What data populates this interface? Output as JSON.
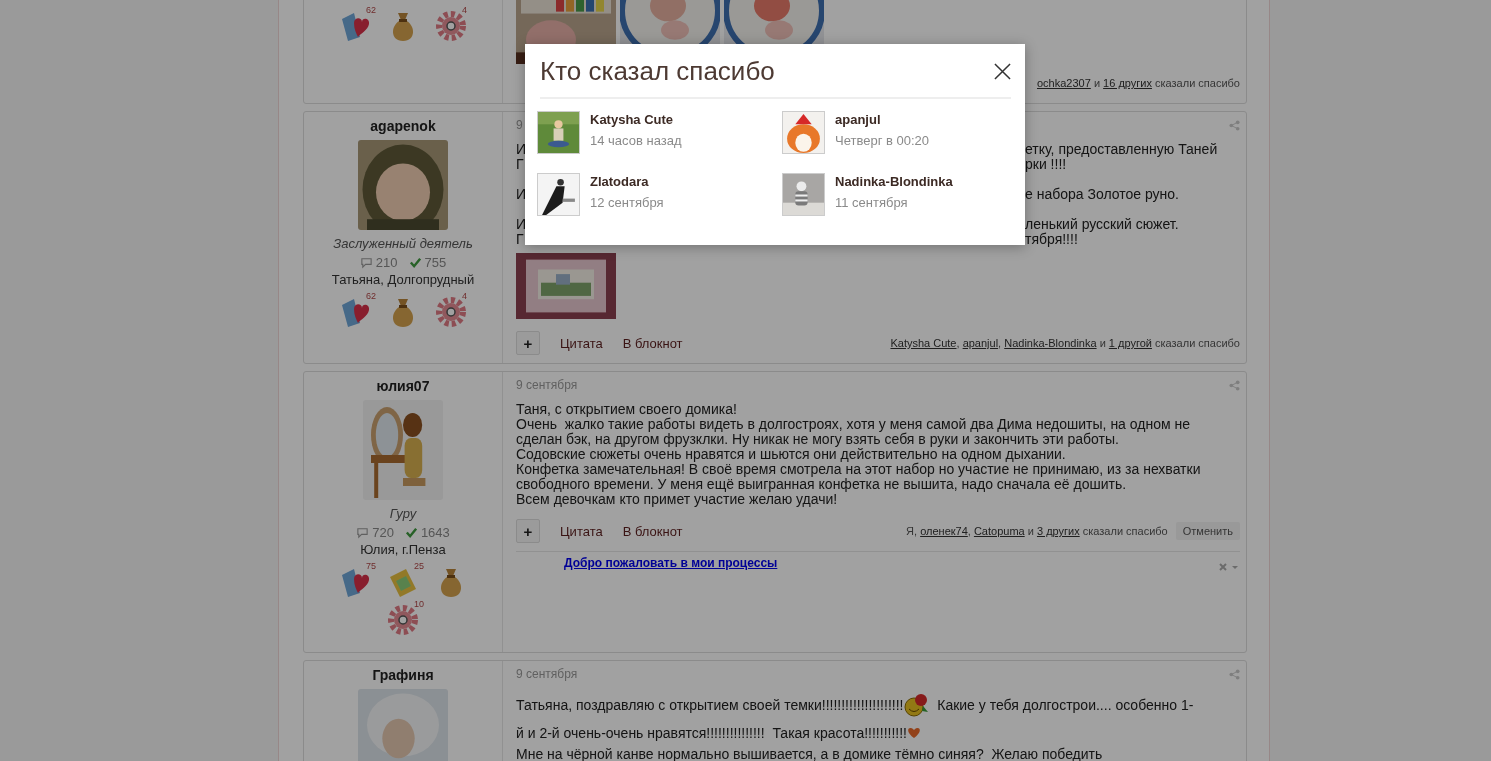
{
  "posts": [
    {
      "badges": [
        {
          "kind": "heart",
          "count": "62"
        },
        {
          "kind": "bag"
        },
        {
          "kind": "gear",
          "count": "4"
        }
      ],
      "attachments": [
        {
          "kind": "picture"
        },
        {
          "kind": "picture"
        },
        {
          "kind": "picture"
        }
      ],
      "thanks": [
        {
          "kind": "link",
          "text": "ochka2307"
        },
        {
          "kind": "text",
          "text": " и "
        },
        {
          "kind": "link",
          "text": "16 других"
        },
        {
          "kind": "text",
          "text": " сказали спасибо"
        }
      ]
    },
    {
      "author": "agapenok",
      "avatar": {
        "kind": "picture"
      },
      "rank": "Заслуженный деятель",
      "comments": "210",
      "thanks_count": "755",
      "location": "Татьяна, Долгопрудный",
      "badges": [
        {
          "kind": "heart",
          "count": "62"
        },
        {
          "kind": "bag"
        },
        {
          "kind": "gear",
          "count": "4"
        }
      ],
      "date": "9",
      "body": [
        [
          {
            "kind": "split",
            "left": "И",
            "right": "етку, предоставленную Таней"
          },
          {
            "kind": "split",
            "left": "Г",
            "right": "рки !!!!"
          }
        ],
        [
          {
            "kind": "split",
            "left": "И",
            "right": "е набора Золотое руно."
          }
        ],
        [
          {
            "kind": "split",
            "left": "И",
            "right": "ленький русский сюжет."
          },
          {
            "kind": "split",
            "left": "Г",
            "right": "тября!!!!"
          }
        ]
      ],
      "attachments": [
        {
          "kind": "picture"
        }
      ],
      "actions": [
        {
          "kind": "button",
          "text": "+"
        },
        {
          "kind": "link",
          "text": "Цитата"
        },
        {
          "kind": "link",
          "text": "В блокнот"
        }
      ],
      "thanks": [
        {
          "kind": "link",
          "text": "Katysha Cute"
        },
        {
          "kind": "text",
          "text": ", "
        },
        {
          "kind": "link",
          "text": "apanjul"
        },
        {
          "kind": "text",
          "text": ", "
        },
        {
          "kind": "link",
          "text": "Nadinka-Blondinka"
        },
        {
          "kind": "text",
          "text": " и "
        },
        {
          "kind": "link",
          "text": "1 другой"
        },
        {
          "kind": "text",
          "text": " сказали спасибо"
        }
      ]
    },
    {
      "author": "юлия07",
      "avatar": {
        "kind": "picture"
      },
      "rank": "Гуру",
      "comments": "720",
      "thanks_count": "1643",
      "location": "Юлия, г.Пенза",
      "badges": [
        {
          "kind": "heart",
          "count": "75"
        },
        {
          "kind": "folder",
          "count": "25"
        },
        {
          "kind": "bag"
        },
        {
          "kind": "gear",
          "count": "10"
        }
      ],
      "date": "9 сентября",
      "body": [
        [
          {
            "kind": "flow",
            "parts": [
              {
                "kind": "text",
                "text": "Таня, с открытием своего домика!"
              }
            ]
          },
          {
            "kind": "flow",
            "parts": [
              {
                "kind": "text",
                "text": "Очень  жалко такие работы видеть в долгостроях, хотя у меня самой два Дима недошиты, на одном не"
              }
            ]
          },
          {
            "kind": "flow",
            "parts": [
              {
                "kind": "text",
                "text": "сделан бэк, на другом фрузклки. Ну никак не могу взять себя в руки и закончить эти работы."
              }
            ]
          },
          {
            "kind": "flow",
            "parts": [
              {
                "kind": "text",
                "text": "Содовские сюжеты очень нравятся и шьются они действительно на одном дыхании."
              }
            ]
          },
          {
            "kind": "flow",
            "parts": [
              {
                "kind": "text",
                "text": "Конфетка замечательная! В своё время смотрела на этот набор но участие не принимаю, из за нехватки"
              }
            ]
          },
          {
            "kind": "flow",
            "parts": [
              {
                "kind": "text",
                "text": "свободного времени. У меня ещё выигранная конфетка не вышита, надо сначала её дошить."
              }
            ]
          },
          {
            "kind": "flow",
            "parts": [
              {
                "kind": "text",
                "text": "Всем девочкам кто примет участие желаю удачи!"
              }
            ]
          }
        ]
      ],
      "actions": [
        {
          "kind": "button",
          "text": "+"
        },
        {
          "kind": "link",
          "text": "Цитата"
        },
        {
          "kind": "link",
          "text": "В блокнот"
        }
      ],
      "thanks": [
        {
          "kind": "text",
          "text": "Я, "
        },
        {
          "kind": "link",
          "text": "оленек74"
        },
        {
          "kind": "text",
          "text": ", "
        },
        {
          "kind": "link",
          "text": "Catopuma"
        },
        {
          "kind": "text",
          "text": " и "
        },
        {
          "kind": "link",
          "text": "3 других"
        },
        {
          "kind": "text",
          "text": " сказали спасибо"
        }
      ],
      "cancel": "Отменить",
      "signature": "Добро пожаловать в мои процессы"
    },
    {
      "author": "Графиня",
      "avatar": {
        "kind": "picture"
      },
      "date": "9 сентября",
      "body": [
        [
          {
            "kind": "flow",
            "parts": [
              {
                "kind": "text",
                "text": "Татьяна, поздравляю с открытием своей темки!!!!!!!!!!!!!!!!!!!!!"
              },
              {
                "kind": "emoticon"
              },
              {
                "kind": "text",
                "text": "  Какие у тебя долгострои.... особенно 1-"
              }
            ]
          },
          {
            "kind": "flow",
            "parts": [
              {
                "kind": "text",
                "text": "й и 2-й очень-очень нравятся!!!!!!!!!!!!!!!  Такая красота!!!!!!!!!!!"
              },
              {
                "kind": "heart"
              }
            ]
          },
          {
            "kind": "flow",
            "parts": [
              {
                "kind": "text",
                "text": "Мне на чёрной канве нормально вышивается, а в домике тёмно синяя?  Желаю победить"
              }
            ]
          }
        ]
      ]
    }
  ],
  "dialog": {
    "title": "Кто сказал спасибо",
    "users": [
      {
        "name": "Katysha Cute",
        "time": "14 часов назад"
      },
      {
        "name": "apanjul",
        "time": "Четверг в 00:20"
      },
      {
        "name": "Zlatodara",
        "time": "12 сентября"
      },
      {
        "name": "Nadinka-Blondinka",
        "time": "11 сентября"
      }
    ]
  }
}
